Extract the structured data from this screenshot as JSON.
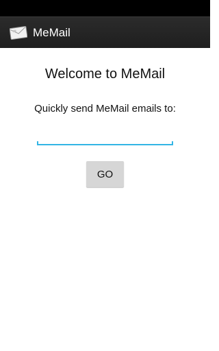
{
  "app": {
    "title": "MeMail",
    "icon": "envelope-icon"
  },
  "main": {
    "welcome": "Welcome to MeMail",
    "prompt": "Quickly send MeMail emails to:",
    "email_value": "",
    "email_placeholder": "",
    "go_label": "GO"
  },
  "colors": {
    "action_bar": "#222222",
    "accent": "#33b5e5",
    "button": "#d6d6d6",
    "status_bar": "#000000"
  }
}
